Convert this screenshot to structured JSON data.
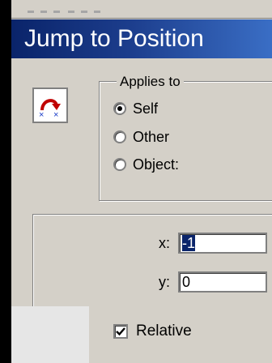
{
  "window": {
    "title": "Jump to Position"
  },
  "applies_to": {
    "legend": "Applies to",
    "options": [
      {
        "label": "Self",
        "selected": true
      },
      {
        "label": "Other",
        "selected": false
      },
      {
        "label": "Object:",
        "selected": false
      }
    ]
  },
  "position": {
    "x_label": "x:",
    "x_value": "-1",
    "y_label": "y:",
    "y_value": "0"
  },
  "relative": {
    "label": "Relative",
    "checked": true
  },
  "icons": {
    "action": "jump-position-icon"
  },
  "colors": {
    "title_start": "#0a246a",
    "title_end": "#3a6ec5",
    "face": "#d4d0c8"
  }
}
